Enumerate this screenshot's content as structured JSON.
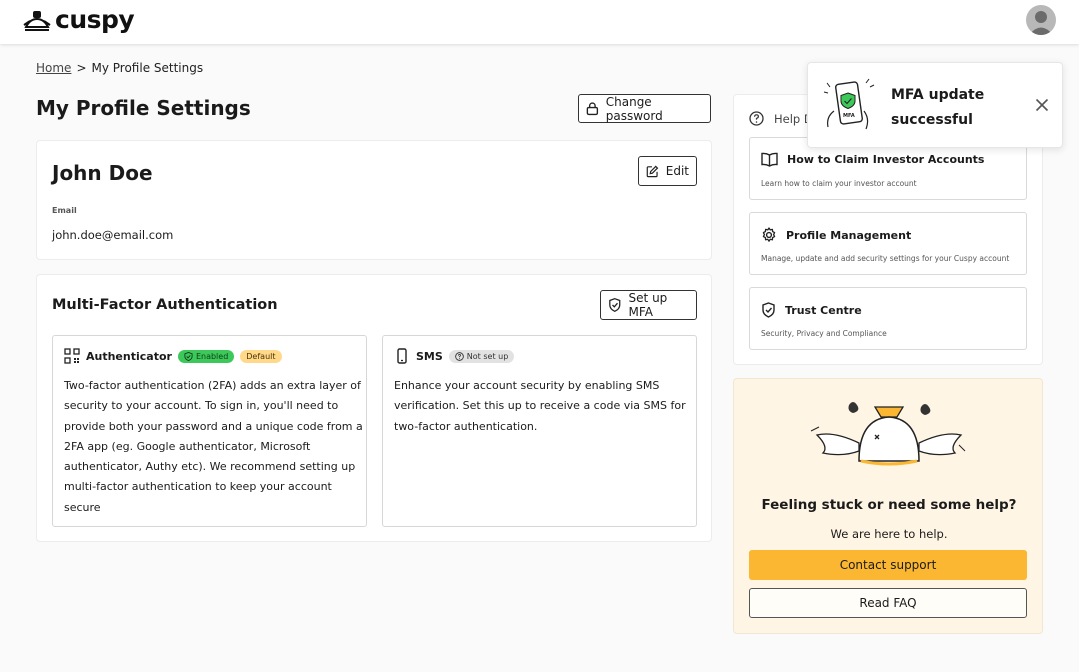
{
  "app": {
    "logo_text": "cuspy"
  },
  "breadcrumb": {
    "home": "Home",
    "separator": ">",
    "current": "My Profile Settings"
  },
  "page": {
    "title": "My Profile Settings",
    "change_password_label": "Change password"
  },
  "profile": {
    "name": "John Doe",
    "edit_label": "Edit",
    "email_label": "Email",
    "email_value": "john.doe@email.com"
  },
  "mfa": {
    "title": "Multi-Factor Authentication",
    "setup_label": "Set up MFA",
    "methods": [
      {
        "name": "Authenticator",
        "icon": "qr-code-icon",
        "badges": [
          "Enabled",
          "Default"
        ],
        "lines": [
          "Two-factor authentication (2FA) adds an extra layer of",
          "security to your account. To sign in, you'll need to",
          "provide both your password and a unique code from a",
          "2FA app (eg. Google authenticator, Microsoft",
          "authenticator, Authy etc). We recommend setting up",
          "multi-factor authentication to keep your account",
          "secure"
        ]
      },
      {
        "name": "SMS",
        "icon": "phone-icon",
        "badges": [
          "Not set up"
        ],
        "lines": [
          "Enhance your account security by enabling SMS",
          "verification. Set this up to receive a code via SMS for",
          "two-factor authentication."
        ]
      }
    ]
  },
  "help": {
    "title": "Help D",
    "items": [
      {
        "title": "How to Claim Investor Accounts",
        "desc": "Learn how to claim your investor account",
        "icon": "book-icon"
      },
      {
        "title": "Profile Management",
        "desc": "Manage, update and add security settings for your Cuspy account",
        "icon": "gear-icon"
      },
      {
        "title": "Trust Centre",
        "desc": "Security, Privacy and Compliance",
        "icon": "shield-check-icon"
      }
    ]
  },
  "support": {
    "title": "Feeling stuck or need some help?",
    "subtitle": "We are here to help.",
    "contact_label": "Contact support",
    "faq_label": "Read FAQ"
  },
  "toast": {
    "line1": "MFA update",
    "line2": "successful",
    "illustration_label": "MFA"
  },
  "colors": {
    "accent": "#fbb731",
    "enabled_green": "#3dc95a",
    "default_yellow": "#ffd88a",
    "support_bg": "#fff5e4"
  }
}
